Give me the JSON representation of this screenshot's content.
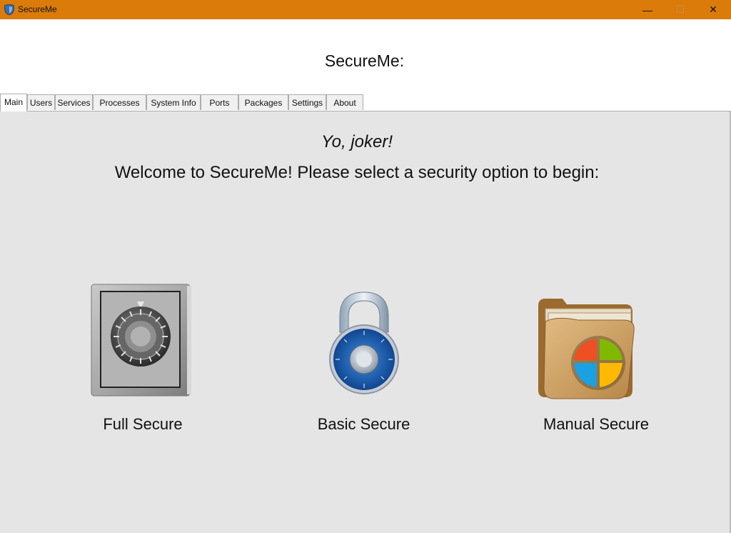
{
  "window": {
    "title": "SecureMe",
    "minimize_glyph": "—",
    "maximize_glyph": "☐",
    "close_glyph": "✕"
  },
  "header": {
    "app_title": "SecureMe:"
  },
  "tabs": [
    {
      "label": "Main",
      "active": true
    },
    {
      "label": "Users"
    },
    {
      "label": "Services"
    },
    {
      "label": "Processes"
    },
    {
      "label": "System Info"
    },
    {
      "label": "Ports"
    },
    {
      "label": "Packages"
    },
    {
      "label": "Settings"
    },
    {
      "label": "About"
    }
  ],
  "main": {
    "greeting": "Yo, joker!",
    "welcome": "Welcome to SecureMe! Please select a security option to begin:",
    "options": [
      {
        "label": "Full Secure",
        "icon": "safe-icon"
      },
      {
        "label": "Basic Secure",
        "icon": "padlock-icon"
      },
      {
        "label": "Manual Secure",
        "icon": "folder-windows-icon"
      }
    ]
  },
  "colors": {
    "titlebar": "#da7b0a",
    "content_bg": "#e5e5e5"
  }
}
